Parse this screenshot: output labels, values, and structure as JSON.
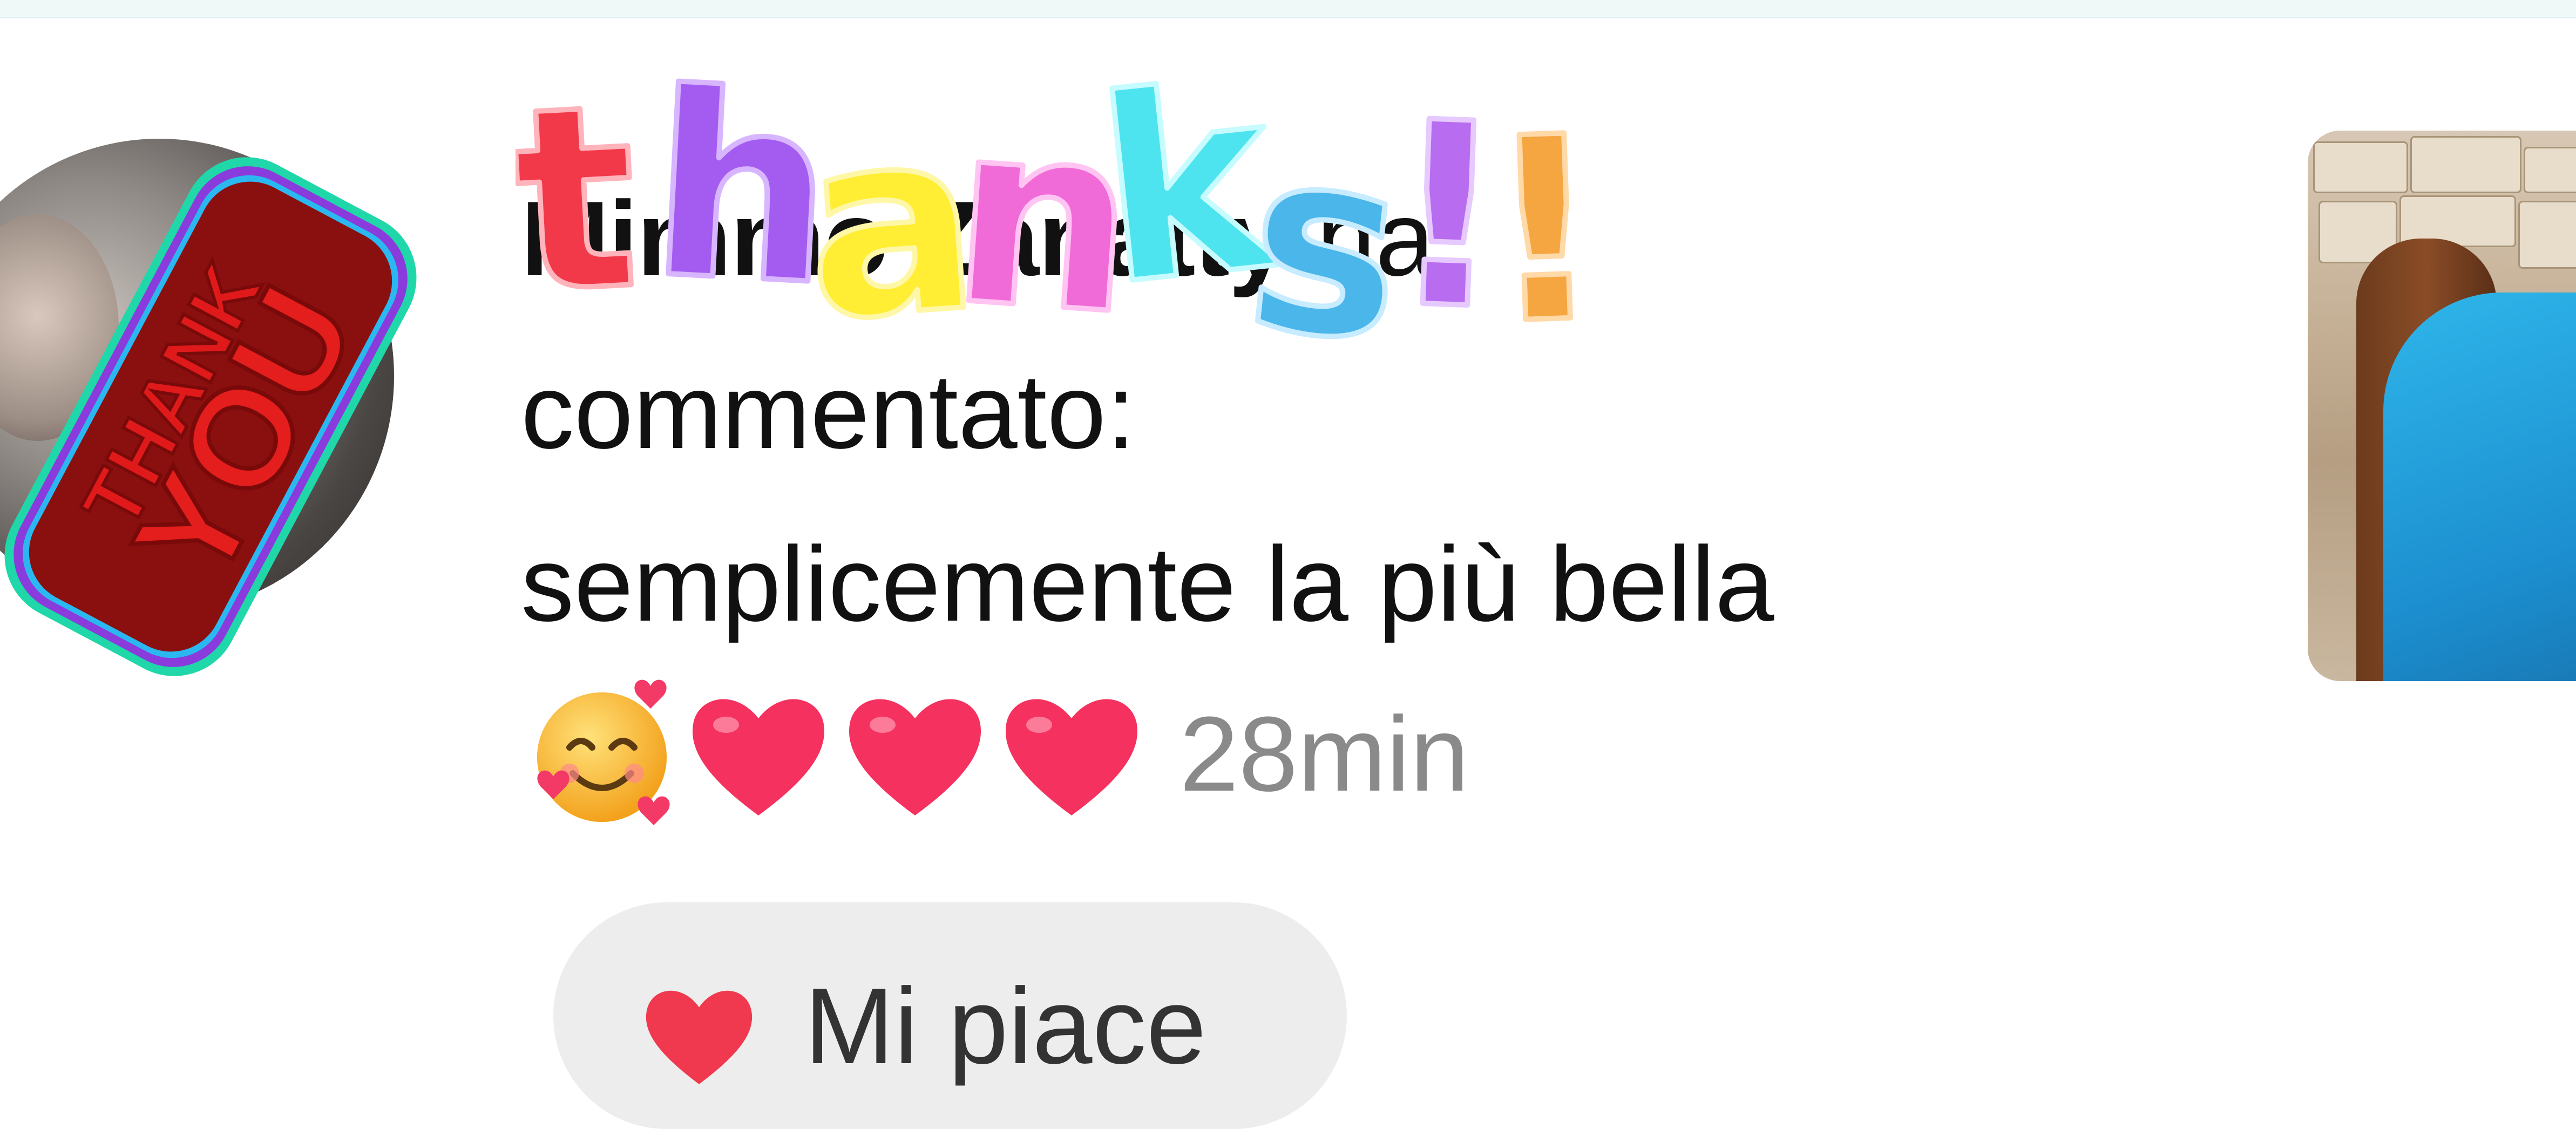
{
  "notification": {
    "author": "Mimmo Zanatty",
    "action": "ha",
    "action_line2": "commentato:",
    "comment": "semplicemente la più bella",
    "time": "28min"
  },
  "like_button": {
    "label": "Mi piace"
  },
  "stickers": {
    "thank_you_text_1": "THANK",
    "thank_you_text_2": "YOU",
    "thanks_letters": [
      "t",
      "h",
      "a",
      "n",
      "k",
      "s",
      "!",
      "!"
    ]
  },
  "colors": {
    "text": "#111111",
    "time": "#8a8a8a",
    "like_bg": "#ededed",
    "heart": "#f0394f",
    "thanks": [
      "#f2394a",
      "#a45cf0",
      "#ffee33",
      "#f06ad8",
      "#4ee4ef",
      "#4ab6ea",
      "#b86cf0",
      "#f5a640"
    ]
  },
  "icons": {
    "emoji_1": "smiling-face-with-hearts-icon",
    "emoji_heart": "red-heart-icon",
    "like": "heart-icon"
  }
}
